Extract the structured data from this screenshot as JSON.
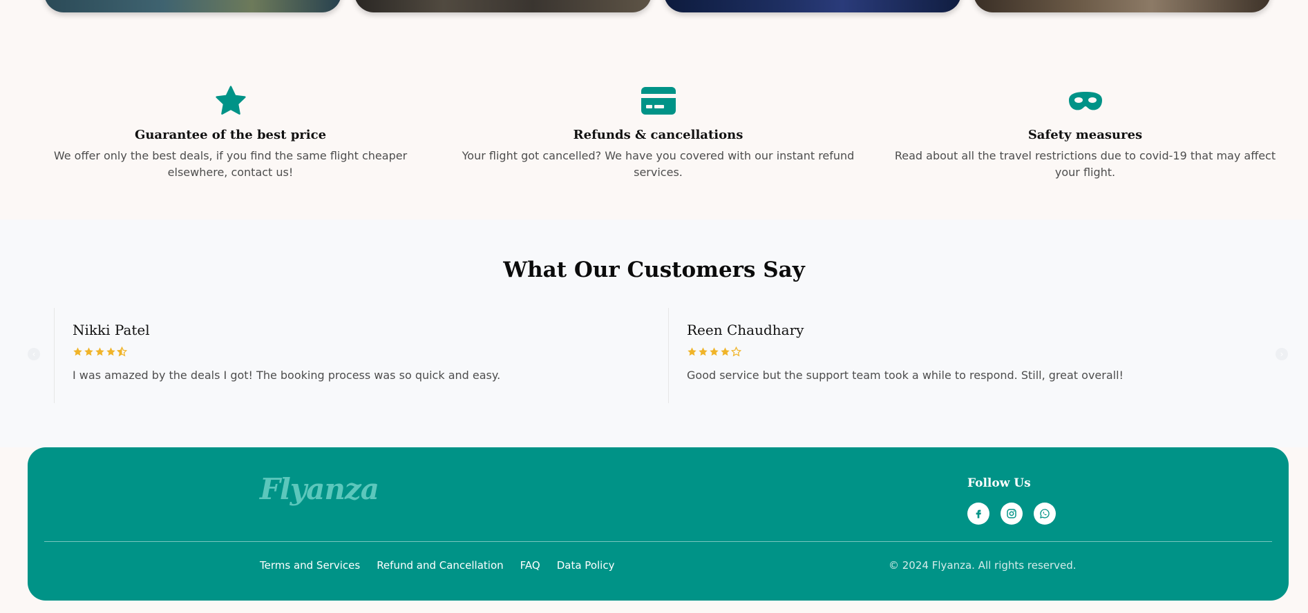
{
  "destination_cards": [
    {
      "name": "destination-card-1"
    },
    {
      "name": "destination-card-2"
    },
    {
      "name": "destination-card-3"
    },
    {
      "name": "destination-card-4"
    }
  ],
  "features": [
    {
      "icon": "star-icon",
      "title": "Guarantee of the best price",
      "desc": "We offer only the best deals, if you find the same flight cheaper elsewhere, contact us!"
    },
    {
      "icon": "credit-card-icon",
      "title": "Refunds & cancellations",
      "desc": "Your flight got cancelled? We have you covered with our instant refund services."
    },
    {
      "icon": "mask-icon",
      "title": "Safety measures",
      "desc": "Read about all the travel restrictions due to covid-19 that may affect your flight."
    }
  ],
  "testimonials": {
    "title": "What Our Customers Say",
    "reviews": [
      {
        "name": "Nikki Patel",
        "rating": 4.5,
        "text": "I was amazed by the deals I got! The booking process was so quick and easy."
      },
      {
        "name": "Reen Chaudhary",
        "rating": 4,
        "text": "Good service but the support team took a while to respond. Still, great overall!"
      }
    ],
    "star_color": "#f0b429"
  },
  "footer": {
    "logo": "Flyanza",
    "follow_title": "Follow Us",
    "socials": [
      "facebook-icon",
      "instagram-icon",
      "whatsapp-icon"
    ],
    "links": [
      "Terms and Services",
      "Refund and Cancellation",
      "FAQ",
      "Data Policy"
    ],
    "copyright": "© 2024 Flyanza. All rights reserved.",
    "background": "#009387"
  },
  "colors": {
    "accent": "#009387",
    "page_bg": "#fcf8f6",
    "section_bg": "#f8f9fb"
  }
}
